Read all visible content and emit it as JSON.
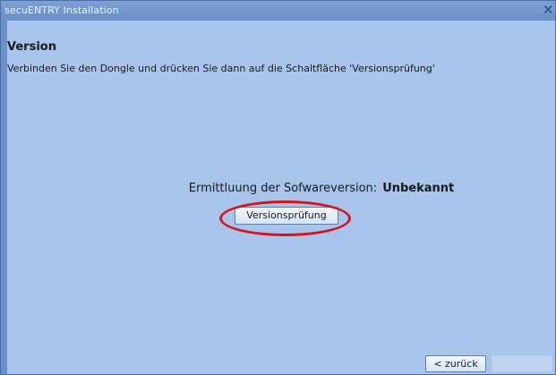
{
  "window": {
    "title": "secuENTRY Installation"
  },
  "page": {
    "heading": "Version",
    "description": "Verbinden Sie den Dongle und drücken Sie dann auf die Schaltfläche 'Versionsprüfung'"
  },
  "status": {
    "label": "Ermittluung der Sofwareversion:",
    "value": "Unbekannt"
  },
  "buttons": {
    "check_label": "Versionsprüfung",
    "back_label": "< zurück"
  },
  "colors": {
    "window_background": "#a9c4ea",
    "titlebar": "#6a8fc9",
    "highlight": "#d3151b"
  },
  "icons": {
    "close": "close-icon"
  }
}
